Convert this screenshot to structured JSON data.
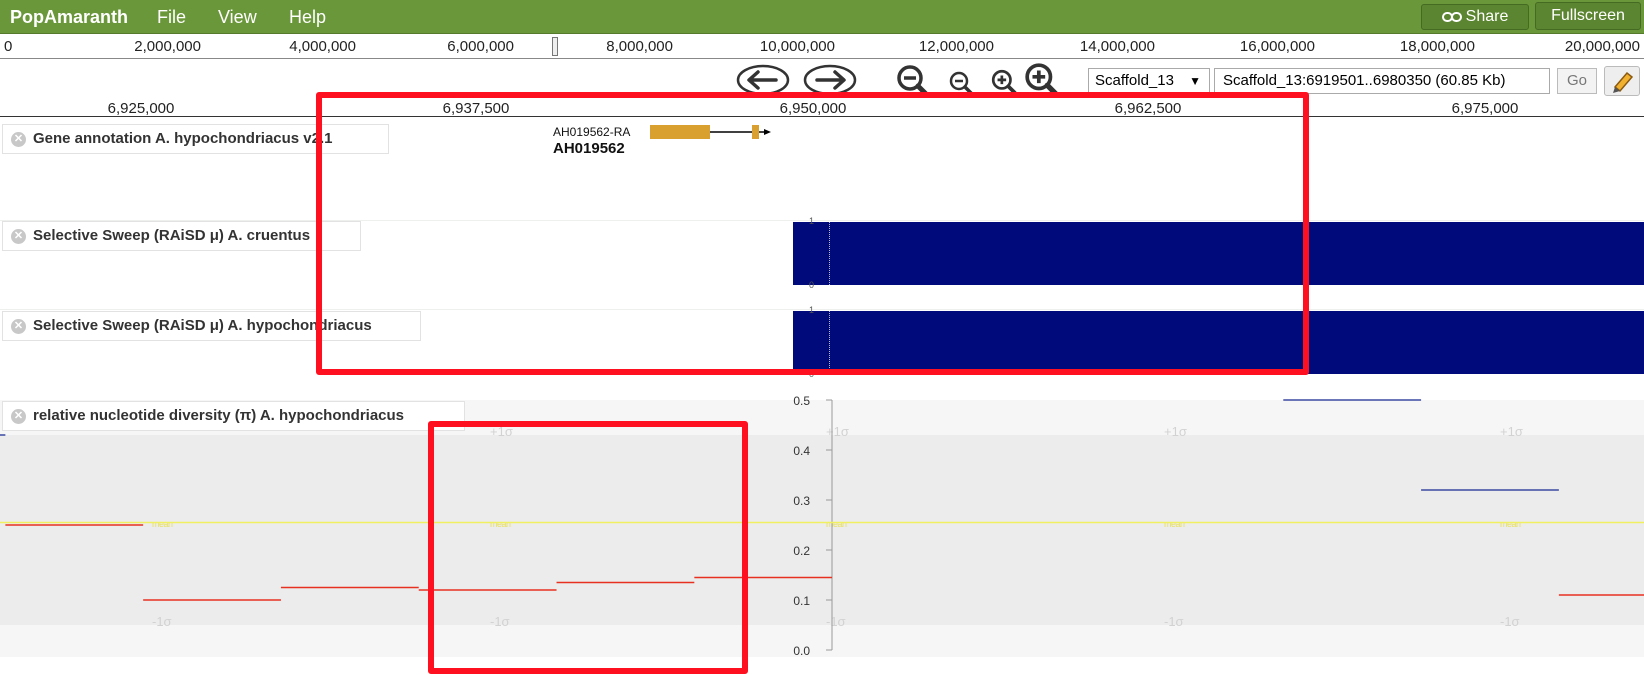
{
  "app": {
    "title": "PopAmaranth",
    "menu": [
      "File",
      "View",
      "Help"
    ],
    "share_label": "Share",
    "fullscreen_label": "Fullscreen"
  },
  "overview_ruler": {
    "ticks": [
      "0",
      "2,000,000",
      "4,000,000",
      "6,000,000",
      "8,000,000",
      "10,000,000",
      "12,000,000",
      "14,000,000",
      "16,000,000",
      "18,000,000",
      "20,000,000"
    ]
  },
  "navigation": {
    "reference_sequence": "Scaffold_13",
    "location": "Scaffold_13:6919501..6980350 (60.85 Kb)",
    "go_label": "Go",
    "icons": [
      "pan-left-icon",
      "pan-right-icon",
      "zoom-out-big-icon",
      "zoom-out-small-icon",
      "zoom-in-small-icon",
      "zoom-in-big-icon",
      "highlight-icon"
    ]
  },
  "detail_ruler": {
    "ticks": [
      "6,925,000",
      "6,937,500",
      "6,950,000",
      "6,962,500",
      "6,975,000"
    ]
  },
  "tracks": {
    "gene_annotation": {
      "label": "Gene annotation A. hypochondriacus v2.1",
      "feature_name": "AH019562-RA",
      "feature_id": "AH019562",
      "feature_color": "#d9a030"
    },
    "sweep_cruentus": {
      "label": "Selective Sweep (RAiSD μ) A. cruentus",
      "axis_max": "1",
      "axis_min": "0",
      "color": "#000a7a"
    },
    "sweep_hypochondriacus": {
      "label": "Selective Sweep (RAiSD μ) A. hypochondriacus",
      "axis_max": "1",
      "axis_min": "0",
      "color": "#000a7a"
    },
    "diversity": {
      "label": "relative nucleotide diversity (π) A. hypochondriacus",
      "y_ticks": [
        "0.5",
        "0.4",
        "0.3",
        "0.2",
        "0.1",
        "0.0"
      ],
      "sigma_upper": "+1σ",
      "sigma_lower": "-1σ",
      "mean_tag": "mean",
      "above_color": "#3a4aa0",
      "below_color": "#e83020",
      "mean_color": "#f0f060"
    }
  },
  "chart_data": {
    "type": "line",
    "title": "",
    "ylabel": "",
    "ylim": [
      0,
      0.5
    ],
    "mean": 0.255,
    "segments": [
      {
        "start": 6919501,
        "end": 6919700,
        "value": 0.43
      },
      {
        "start": 6919700,
        "end": 6924800,
        "value": 0.25
      },
      {
        "start": 6924800,
        "end": 6929900,
        "value": 0.1
      },
      {
        "start": 6929900,
        "end": 6935000,
        "value": 0.125
      },
      {
        "start": 6935000,
        "end": 6940100,
        "value": 0.12
      },
      {
        "start": 6940100,
        "end": 6945200,
        "value": 0.135
      },
      {
        "start": 6945200,
        "end": 6950300,
        "value": 0.145
      },
      {
        "start": 6967000,
        "end": 6972100,
        "value": 0.5
      },
      {
        "start": 6972100,
        "end": 6977200,
        "value": 0.32
      },
      {
        "start": 6977200,
        "end": 6982300,
        "value": 0.11
      }
    ]
  }
}
